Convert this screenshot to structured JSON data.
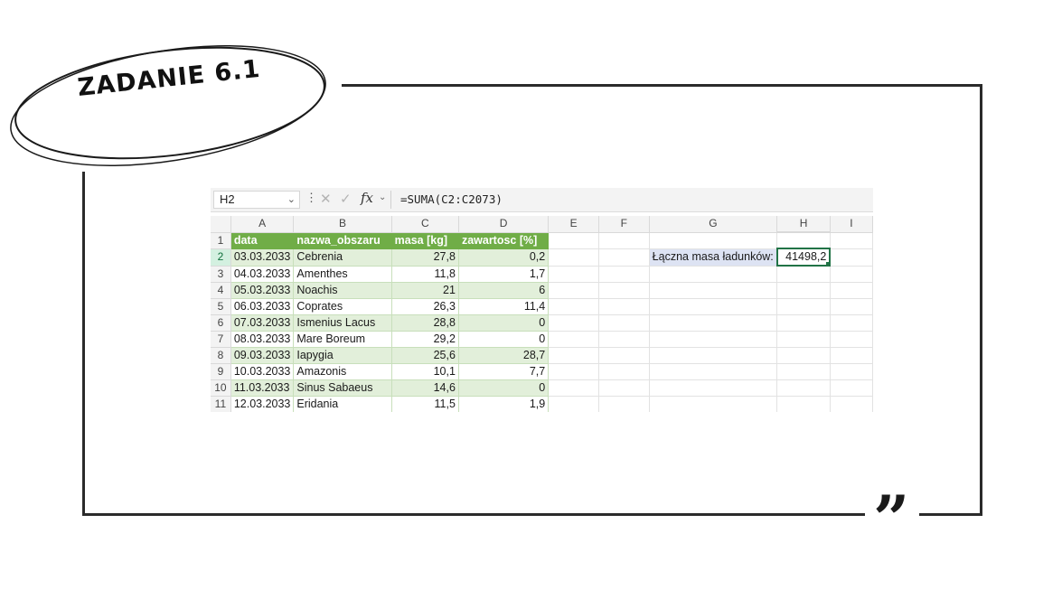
{
  "slide": {
    "title": "ZADANIE 6.1",
    "quote_mark": "”"
  },
  "excel": {
    "name_box": "H2",
    "formula": "=SUMA(C2:C2073)",
    "columns": [
      "A",
      "B",
      "C",
      "D",
      "E",
      "F",
      "G",
      "H",
      "I"
    ],
    "header_row": {
      "row_number": "1",
      "cells": [
        "data",
        "nazwa_obszaru",
        "masa [kg]",
        "zawartosc [%]"
      ]
    },
    "rows": [
      {
        "n": "2",
        "date": "03.03.2033",
        "name": "Cebrenia",
        "mass": "27,8",
        "content": "0,2"
      },
      {
        "n": "3",
        "date": "04.03.2033",
        "name": "Amenthes",
        "mass": "11,8",
        "content": "1,7"
      },
      {
        "n": "4",
        "date": "05.03.2033",
        "name": "Noachis",
        "mass": "21",
        "content": "6"
      },
      {
        "n": "5",
        "date": "06.03.2033",
        "name": "Coprates",
        "mass": "26,3",
        "content": "11,4"
      },
      {
        "n": "6",
        "date": "07.03.2033",
        "name": "Ismenius Lacus",
        "mass": "28,8",
        "content": "0"
      },
      {
        "n": "7",
        "date": "08.03.2033",
        "name": "Mare Boreum",
        "mass": "29,2",
        "content": "0"
      },
      {
        "n": "8",
        "date": "09.03.2033",
        "name": "Iapygia",
        "mass": "25,6",
        "content": "28,7"
      },
      {
        "n": "9",
        "date": "10.03.2033",
        "name": "Amazonis",
        "mass": "10,1",
        "content": "7,7"
      },
      {
        "n": "10",
        "date": "11.03.2033",
        "name": "Sinus Sabaeus",
        "mass": "14,6",
        "content": "0"
      },
      {
        "n": "11",
        "date": "12.03.2033",
        "name": "Eridania",
        "mass": "11,5",
        "content": "1,9"
      }
    ],
    "summary": {
      "label": "Łączna masa ładunków:",
      "value": "41498,2"
    },
    "colors": {
      "table_header": "#70ad47",
      "band": "#e2efda",
      "selection": "#217346",
      "label_fill": "#dde3f3"
    }
  }
}
